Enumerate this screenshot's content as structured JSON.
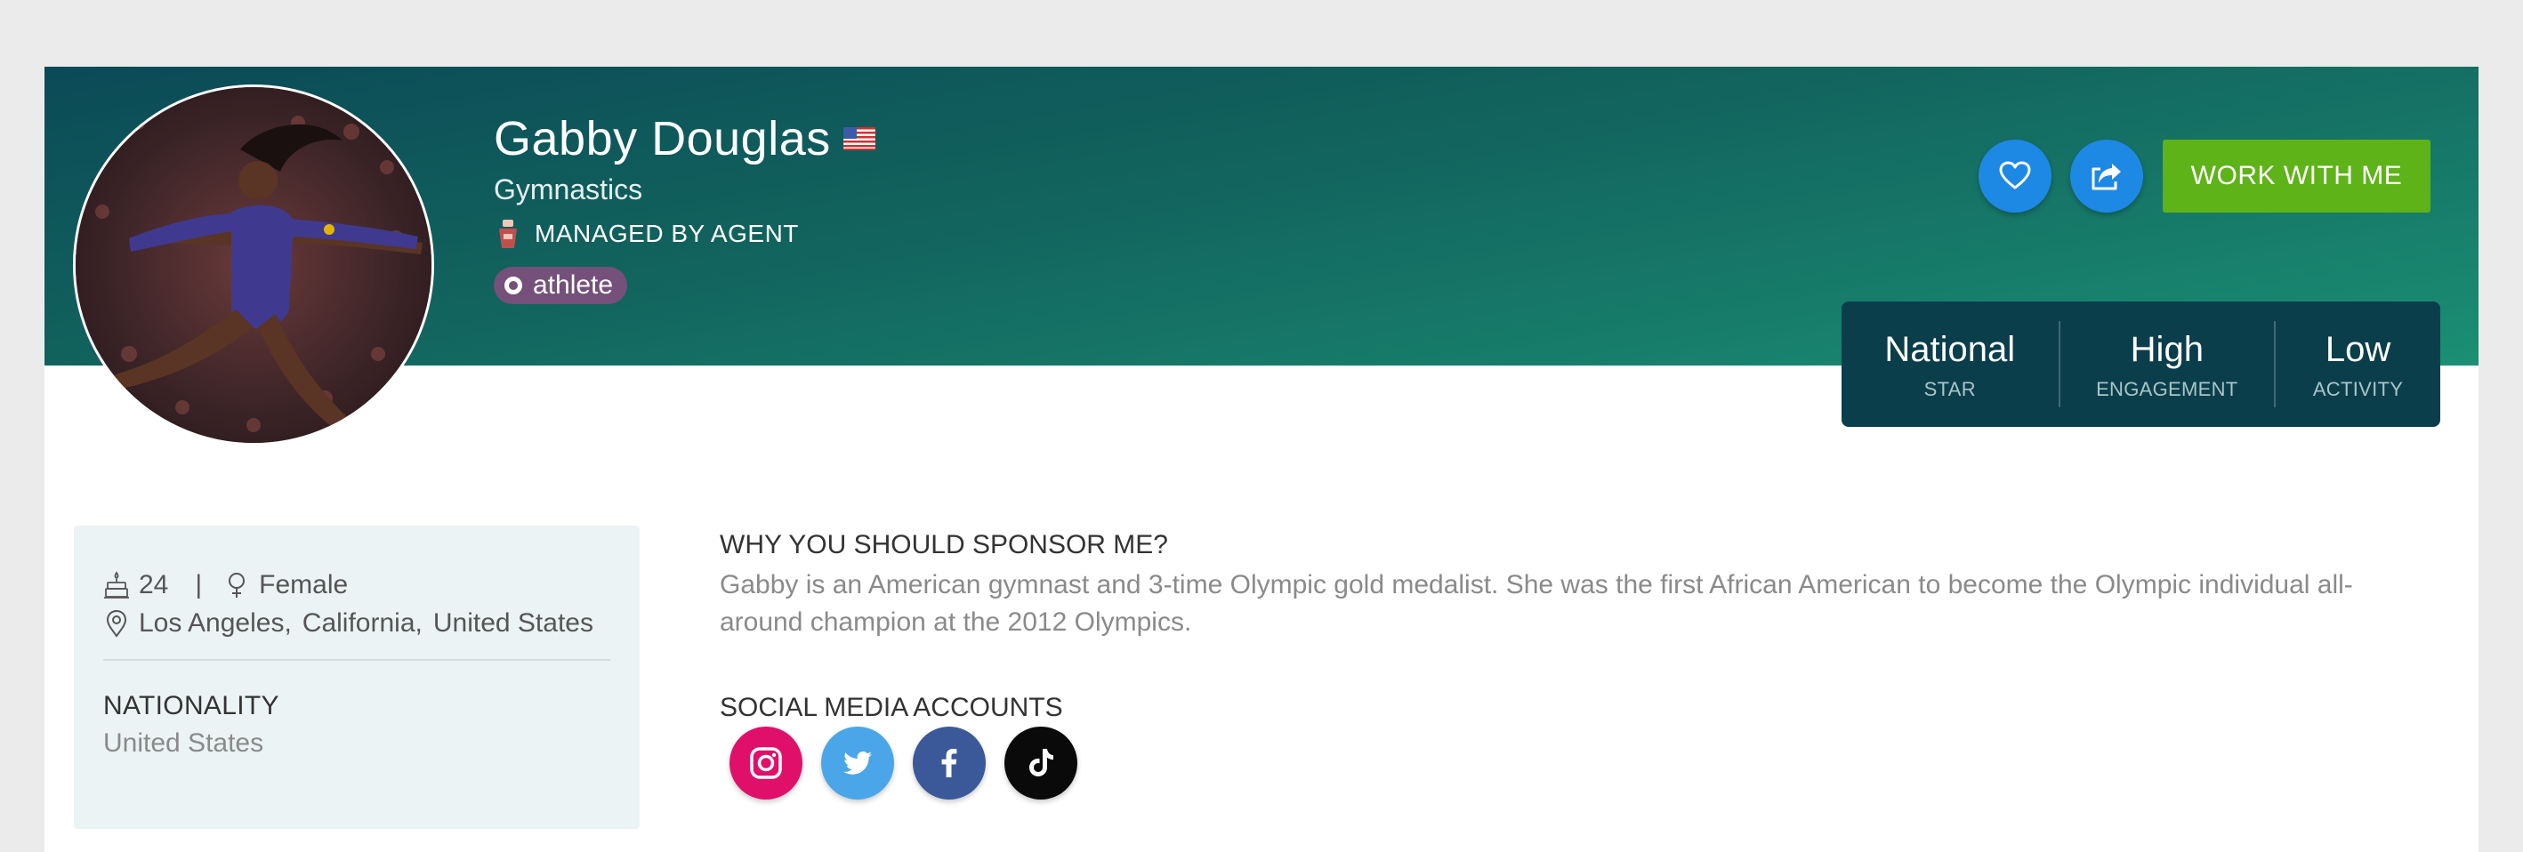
{
  "profile": {
    "name": "Gabby Douglas",
    "flag_icon": "us-flag-icon",
    "sport": "Gymnastics",
    "managed_label": "MANAGED BY AGENT",
    "managed_icon": "agent-icon",
    "badge": "athlete"
  },
  "actions": {
    "favorite_icon": "heart-icon",
    "share_icon": "share-icon",
    "work_button": "WORK WITH ME"
  },
  "stats": [
    {
      "value": "National",
      "label": "STAR"
    },
    {
      "value": "High",
      "label": "ENGAGEMENT"
    },
    {
      "value": "Low",
      "label": "ACTIVITY"
    }
  ],
  "details": {
    "age": "24",
    "separator": "|",
    "gender": "Female",
    "city": "Los Angeles,",
    "state": "California,",
    "country": "United States",
    "nationality_label": "NATIONALITY",
    "nationality_value": "United States"
  },
  "sponsor": {
    "title": "WHY YOU SHOULD SPONSOR ME?",
    "text": "Gabby is an American gymnast and 3-time Olympic gold medalist. She was the first African American to become the Olympic individual all-around champion at the 2012 Olympics."
  },
  "social": {
    "title": "SOCIAL MEDIA ACCOUNTS",
    "accounts": [
      {
        "icon": "instagram-icon",
        "color": "#e0106a"
      },
      {
        "icon": "twitter-icon",
        "color": "#4aa6e8"
      },
      {
        "icon": "facebook-icon",
        "color": "#3b5998"
      },
      {
        "icon": "tiktok-icon",
        "color": "#0a0a0a"
      }
    ]
  },
  "colors": {
    "banner_dark": "#0b4a57",
    "banner_light": "#1b8f74",
    "primary_button": "#5eb318",
    "icon_button": "#1e88e5",
    "stats_panel": "#0b3e4b",
    "badge": "#74507a"
  }
}
